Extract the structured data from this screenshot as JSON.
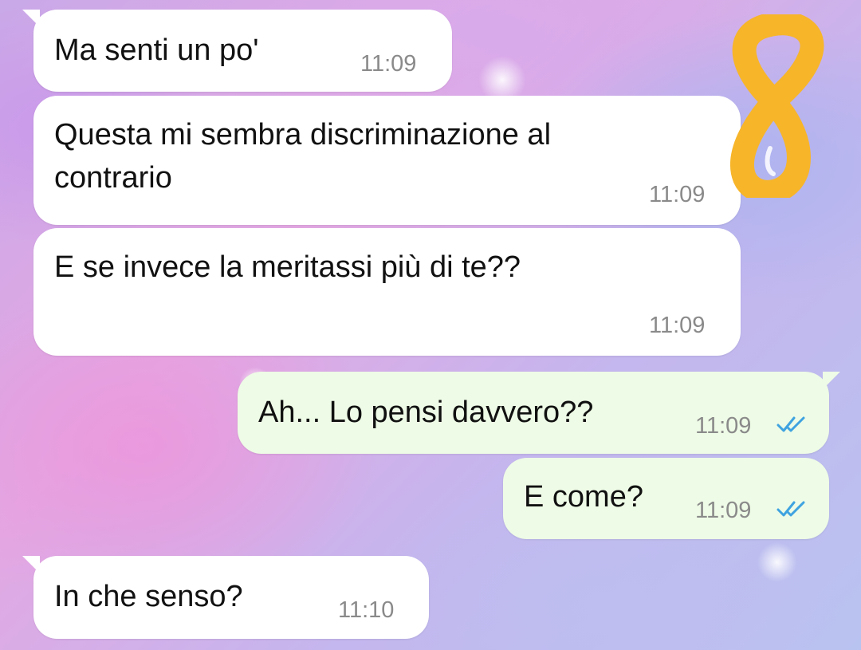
{
  "messages": [
    {
      "direction": "incoming",
      "text": "Ma senti un po'",
      "time": "11:09"
    },
    {
      "direction": "incoming",
      "text": "Questa mi sembra discriminazione al\ncontrario",
      "time": "11:09"
    },
    {
      "direction": "incoming",
      "text": "E se invece la meritassi più di te??",
      "time": "11:09"
    },
    {
      "direction": "outgoing",
      "text": "Ah... Lo pensi davvero??",
      "time": "11:09",
      "status": "read"
    },
    {
      "direction": "outgoing",
      "text": "E come?",
      "time": "11:09",
      "status": "read"
    },
    {
      "direction": "incoming",
      "text": "In che senso?",
      "time": "11:10"
    }
  ],
  "overlay": {
    "icon": "handwritten-number-8-icon",
    "color": "#f7b52a"
  },
  "colors": {
    "incoming_bubble": "#ffffff",
    "outgoing_bubble": "#eefbe6",
    "read_ticks": "#3fa3e0",
    "time": "#8a8a8a"
  }
}
